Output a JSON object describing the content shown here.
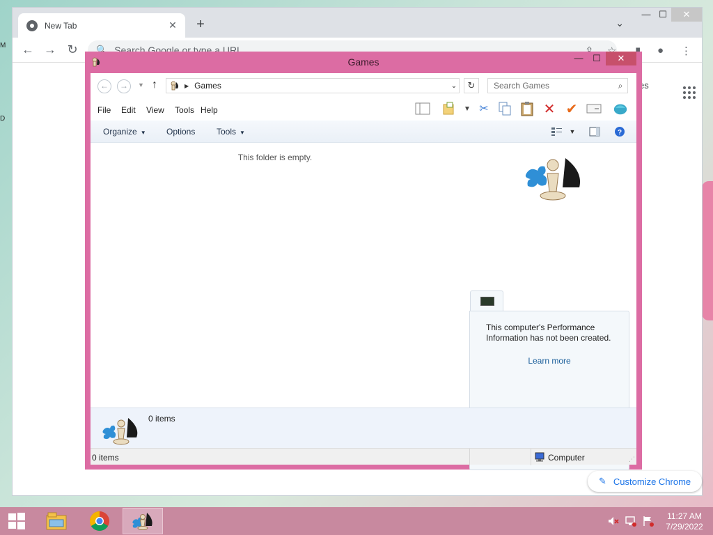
{
  "desktop": {
    "edge_glyph_a": "M",
    "edge_glyph_b": "D"
  },
  "chrome": {
    "tab_title": "New Tab",
    "tab_close": "✕",
    "new_tab_symbol": "+",
    "omnibox_placeholder": "Search Google or type a URL",
    "ntp_link": "es",
    "customize_label": "Customize Chrome",
    "window_controls": {
      "minimize": "—",
      "maximize": "☐",
      "close": "✕"
    }
  },
  "games_window": {
    "title": "Games",
    "address_crumb": "Games",
    "search_placeholder": "Search Games",
    "window_controls": {
      "minimize": "—",
      "maximize": "☐",
      "close": "✕"
    },
    "menu": [
      "File",
      "Edit",
      "View",
      "Tools",
      "Help"
    ],
    "commands": {
      "organize": "Organize",
      "options": "Options",
      "tools": "Tools"
    },
    "empty_message": "This folder is empty.",
    "performance_message": "This computer's Performance Information has not been created.",
    "learn_more": "Learn more",
    "details_count": "0 items",
    "status_left": "0 items",
    "status_right": "Computer",
    "accent_color": "#dc6ca3"
  },
  "taskbar": {
    "time": "11:27 AM",
    "date": "7/29/2022",
    "color": "#c8899f"
  }
}
